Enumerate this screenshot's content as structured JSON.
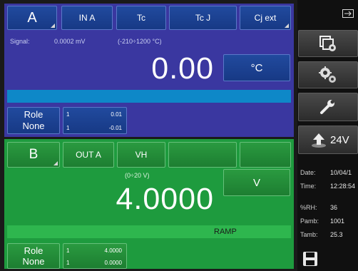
{
  "channel_a": {
    "label": "A",
    "tabs": [
      "IN A",
      "Tc",
      "Tc J",
      "Cj ext"
    ],
    "signal_label": "Signal:",
    "signal_value": "0.0002 mV",
    "range": "(-210÷1200 °C)",
    "reading": "0.00",
    "unit": "°C",
    "role_label": "Role",
    "role_value": "None",
    "table": [
      [
        "1",
        "0.01"
      ],
      [
        "1",
        "-0.01"
      ]
    ]
  },
  "channel_b": {
    "label": "B",
    "tabs": [
      "OUT A",
      "VH",
      "",
      ""
    ],
    "range": "(0÷20 V)",
    "reading": "4.0000",
    "unit": "V",
    "status_bar": "RAMP",
    "role_label": "Role",
    "role_value": "None",
    "table": [
      [
        "1",
        "4.0000"
      ],
      [
        "1",
        "0.0000"
      ]
    ]
  },
  "side": {
    "loop_power": "24V",
    "info": [
      {
        "label": "Date:",
        "value": "10/04/1"
      },
      {
        "label": "Time:",
        "value": "12:28:54"
      },
      {
        "label": "%RH:",
        "value": "36"
      },
      {
        "label": "Pamb:",
        "value": "1001"
      },
      {
        "label": "Tamb:",
        "value": "25.3"
      }
    ]
  },
  "colors": {
    "channel_a_bg": "#3a37a0",
    "channel_b_bg": "#1e9b3e",
    "accent_blue": "#0e88c8",
    "accent_green": "#2eb64e"
  }
}
